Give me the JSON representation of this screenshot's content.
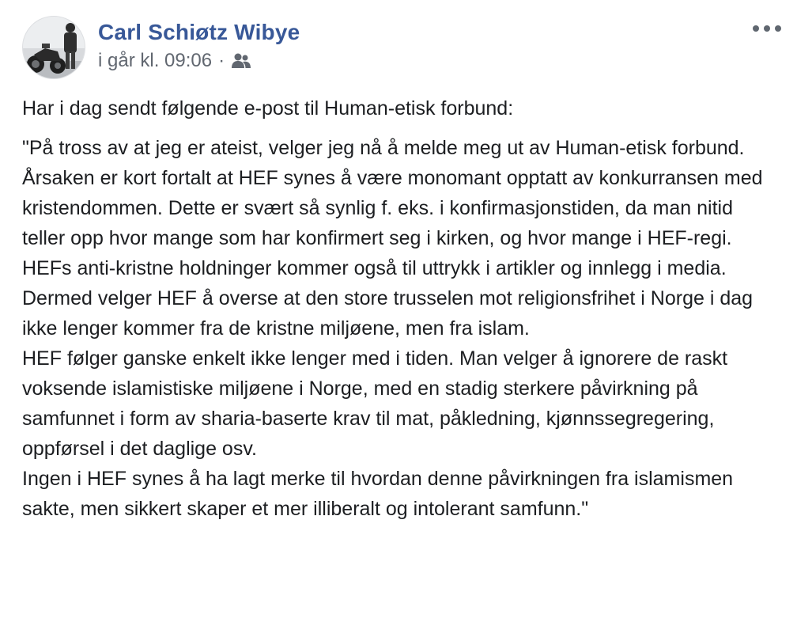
{
  "post": {
    "author": "Carl Schiøtz Wibye",
    "timestamp": "i går kl. 09:06",
    "separator": "·",
    "audience_icon": "friends-icon",
    "more_icon": "more-options-icon",
    "intro": "Har i dag sendt følgende e-post til Human-etisk forbund:",
    "quote": "\"På tross av at jeg er ateist, velger jeg nå å melde meg ut av Human-etisk forbund.\nÅrsaken er kort fortalt at HEF synes å være monomant opptatt av konkurransen med kristendommen. Dette er svært så synlig f. eks. i konfirmasjonstiden, da man nitid teller opp hvor mange som har konfirmert seg i kirken, og hvor mange i HEF-regi. HEFs anti-kristne holdninger kommer også til uttrykk i artikler og innlegg i media.\nDermed velger HEF å overse at den store trusselen mot religionsfrihet i Norge i dag ikke lenger kommer fra de kristne miljøene, men fra islam.\nHEF følger ganske enkelt ikke lenger med i tiden. Man velger å ignorere de raskt voksende islamistiske miljøene i Norge, med en stadig sterkere påvirkning på samfunnet i form av sharia-baserte krav til mat, påkledning, kjønnssegregering, oppførsel i det daglige osv.\nIngen i HEF synes å ha lagt merke til hvordan denne påvirkningen fra islamismen sakte, men sikkert skaper et mer illiberalt og intolerant samfunn.\""
  },
  "colors": {
    "author": "#385898",
    "meta": "#616770",
    "text": "#1c1e21",
    "icon": "#606770"
  }
}
